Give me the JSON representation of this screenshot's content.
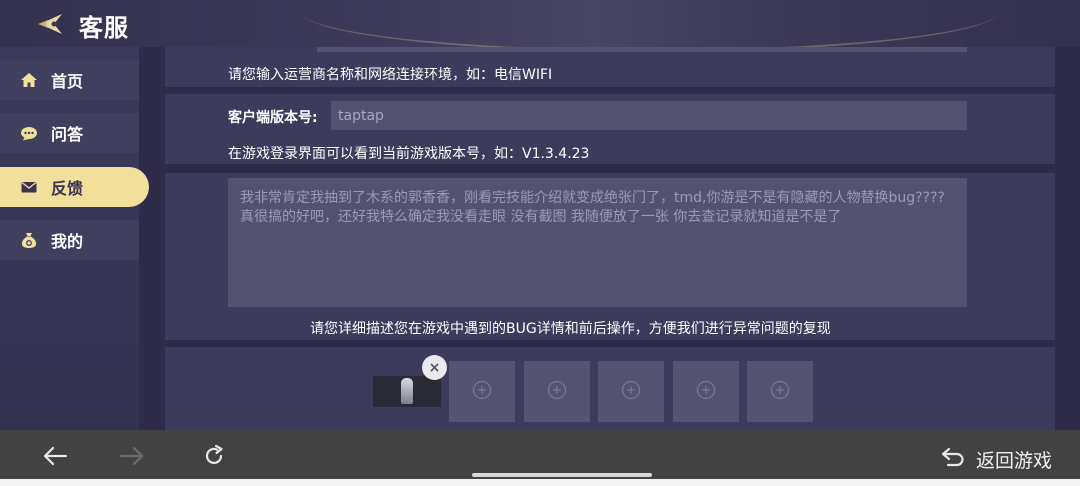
{
  "header": {
    "title": "客服",
    "logo_icon": "winged-emblem-icon"
  },
  "sidebar": {
    "items": [
      {
        "label": "首页",
        "icon": "home-icon",
        "active": false
      },
      {
        "label": "问答",
        "icon": "chat-bubble-icon",
        "active": false
      },
      {
        "label": "反馈",
        "icon": "envelope-icon",
        "active": true
      },
      {
        "label": "我的",
        "icon": "money-bag-icon",
        "active": false
      }
    ]
  },
  "form": {
    "network_hint": "请您输入运营商名称和网络连接环境，如：电信WIFI",
    "version_label": "客户端版本号:",
    "version_value": "taptap",
    "version_hint": "在游戏登录界面可以看到当前游戏版本号，如：V1.3.4.23",
    "description_text": "我非常肯定我抽到了木系的郭香香，刚看完技能介绍就变成绝张门了，tmd,你游是不是有隐藏的人物替换bug????真很搞的好吧，还好我特么确定我没看走眼 没有截图 我随便放了一张 你去查记录就知道是不是了",
    "description_hint": "请您详细描述您在游戏中遇到的BUG详情和前后操作，方便我们进行异常问题的复现",
    "remove_symbol": "×",
    "empty_slot_count": 5
  },
  "bottom_bar": {
    "back_icon": "arrow-left-icon",
    "forward_icon": "arrow-right-icon",
    "refresh_icon": "refresh-icon",
    "return_label": "返回游戏",
    "return_icon": "return-arrow-icon"
  },
  "colors": {
    "active_tab": "#f1df9c",
    "panel": "#3c3b5b",
    "input": "#54536f",
    "bottom_bar": "#424242"
  }
}
